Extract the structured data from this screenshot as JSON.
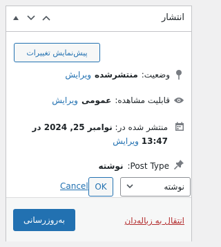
{
  "header": {
    "title": "انتشار",
    "move_up_icon": "chevron-up",
    "move_down_icon": "chevron-down",
    "toggle_icon": "triangle-up"
  },
  "preview_button": "پیش‌نمایش تغییرات",
  "status": {
    "icon": "pin-icon",
    "label": "وضعیت:",
    "value": "منتشرشده",
    "edit": "ویرایش"
  },
  "visibility": {
    "icon": "eye-icon",
    "label": "قابلیت مشاهده:",
    "value": "عمومی",
    "edit": "ویرایش"
  },
  "published": {
    "icon": "calendar-icon",
    "label": "منتشر شده در:",
    "value": "نوامبر 25, 2024 در 13:47",
    "edit": "ویرایش"
  },
  "post_type": {
    "icon": "thumbtack-icon",
    "label": "Post Type:",
    "value": "نوشته",
    "select_value": "نوشته",
    "ok": "OK",
    "cancel": "Cancel"
  },
  "footer": {
    "trash": "انتقال به زباله‌دان",
    "update": "به‌روزرسانی"
  },
  "colors": {
    "accent": "#2271b1",
    "danger": "#b32d2e",
    "border": "#c3c4c7"
  }
}
